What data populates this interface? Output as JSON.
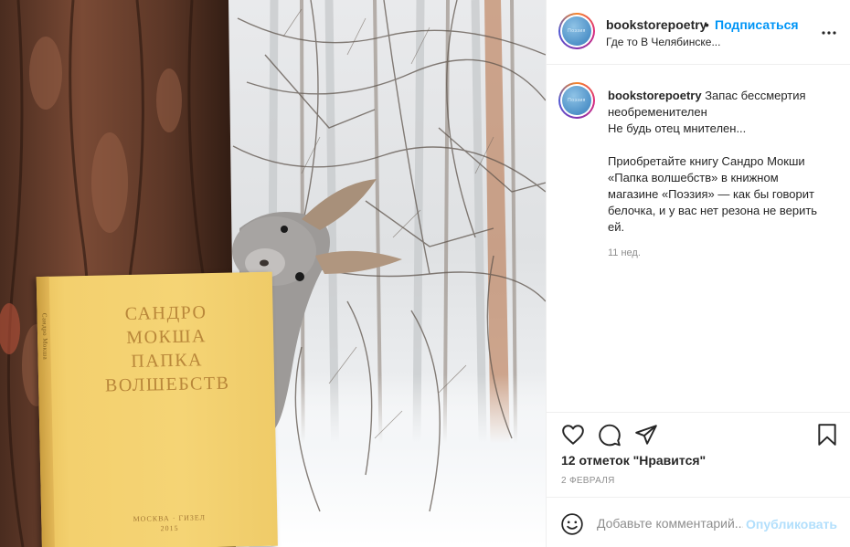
{
  "post": {
    "username": "bookstorepoetry",
    "separator": "•",
    "follow_label": "Подписаться",
    "location": "Где то В Челябинске...",
    "avatar_text": "Поэзия",
    "caption": {
      "username": "bookstorepoetry",
      "line1": "Запас бессмертия необременителен",
      "line2": "Не будь отец мнителен...",
      "paragraph": "Приобретайте книгу Сандро Мокши «Папка волшебств» в книжном магазине «Поэзия» — как бы говорит белочка, и у вас нет резона не верить ей."
    },
    "time_ago": "11 нед.",
    "likes": "12 отметок \"Нравится\"",
    "date": "2 ФЕВРАЛЯ",
    "comment_placeholder": "Добавьте комментарий...",
    "publish_label": "Опубликовать"
  },
  "book": {
    "title_lines": [
      "САНДРО",
      "МОКША",
      "ПАПКА",
      "ВОЛШЕБСТВ"
    ],
    "publisher": "МОСКВА · ГИЗЕЛ",
    "year": "2015",
    "spine": "Сандро Мокша"
  },
  "colors": {
    "accent": "#0095f6",
    "publish_disabled": "#b2dffc",
    "book": "#f5d475",
    "book_text": "#b9873a"
  },
  "icons": [
    "more-icon",
    "heart-icon",
    "comment-icon",
    "share-icon",
    "bookmark-icon",
    "emoji-icon"
  ]
}
